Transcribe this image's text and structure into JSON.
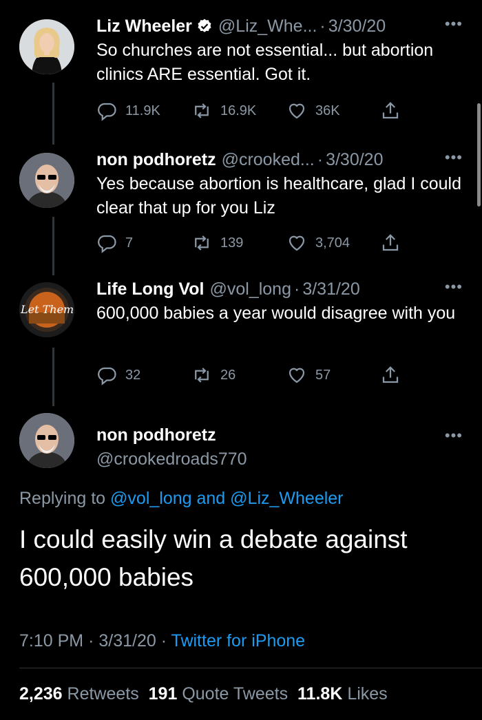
{
  "tweets": [
    {
      "name": "Liz Wheeler",
      "handle": "@Liz_Whe...",
      "date": "3/30/20",
      "verified": true,
      "text": "So churches are not essential... but abortion clinics ARE essential. Got it.",
      "replies": "11.9K",
      "retweets": "16.9K",
      "likes": "36K"
    },
    {
      "name": "non podhoretz",
      "handle": "@crooked...",
      "date": "3/30/20",
      "text": "Yes because abortion is healthcare, glad I could clear that up for you Liz",
      "replies": "7",
      "retweets": "139",
      "likes": "3,704"
    },
    {
      "name": "Life Long Vol",
      "handle": "@vol_long",
      "date": "3/31/20",
      "avatar_text": "Let Them",
      "text": "600,000 babies a year would disagree with you",
      "replies": "32",
      "retweets": "26",
      "likes": "57"
    }
  ],
  "main_tweet": {
    "name": "non podhoretz",
    "handle": "@crookedroads770",
    "replying_prefix": "Replying to",
    "replying_user1": "@vol_long",
    "replying_and": "and",
    "replying_user2": "@Liz_Wheeler",
    "text": "I could easily win a debate against 600,000 babies",
    "time": "7:10 PM",
    "date": "3/31/20",
    "source": "Twitter for iPhone",
    "retweets_count": "2,236",
    "retweets_label": "Retweets",
    "quotes_count": "191",
    "quotes_label": "Quote Tweets",
    "likes_count": "11.8K",
    "likes_label": "Likes"
  },
  "glyphs": {
    "dot": "·",
    "more": "•••"
  },
  "colors": {
    "background": "#000000",
    "link": "#1d9bf0",
    "muted": "#8b98a5",
    "verified": "#ffffff"
  }
}
